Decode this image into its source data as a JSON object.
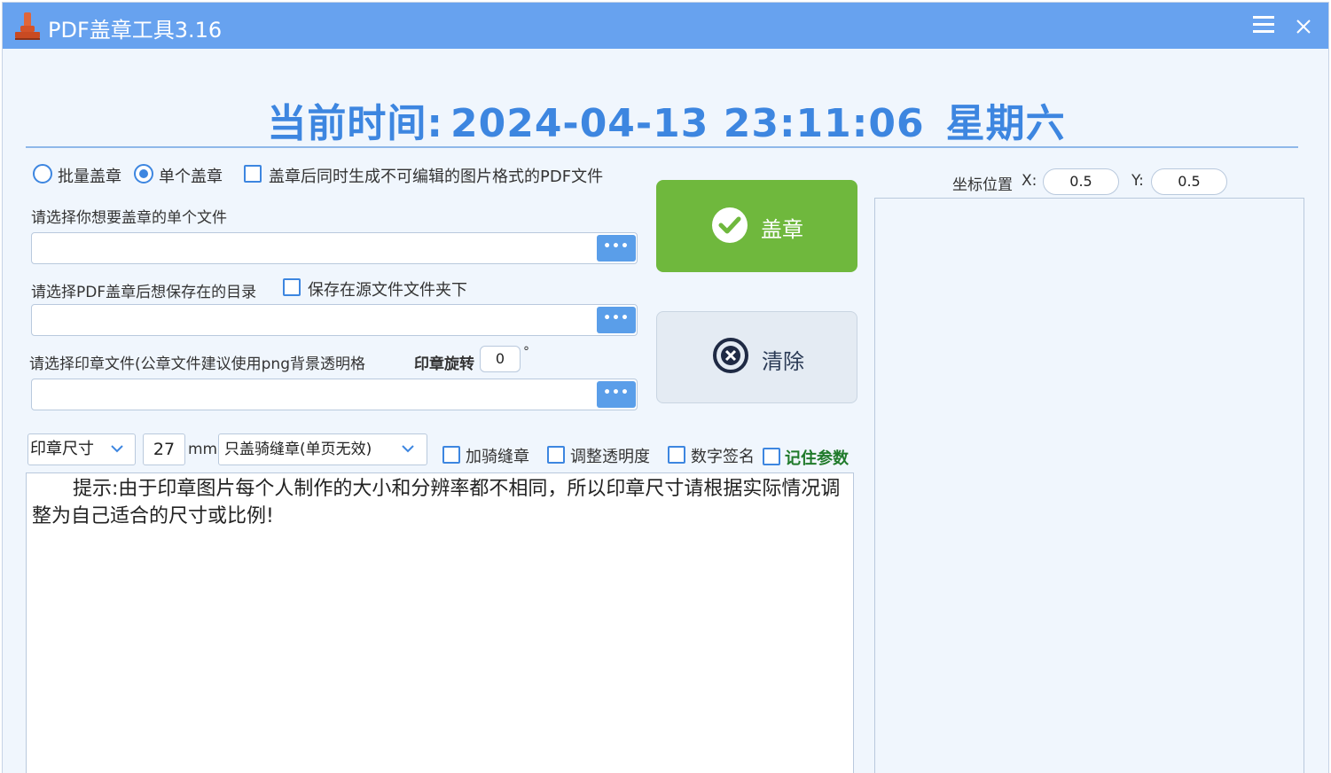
{
  "window": {
    "title": "PDF盖章工具3.16",
    "menu_icon": "hamburger-menu-icon",
    "close_icon": "close-icon",
    "app_icon": "stamp-icon"
  },
  "header": {
    "time_label": "当前时间:",
    "datetime": "2024-04-13 23:11:06",
    "weekday": "星期六"
  },
  "mode": {
    "batch_label": "批量盖章",
    "single_label": "单个盖章",
    "selected": "single",
    "image_pdf_label": "盖章后同时生成不可编辑的图片格式的PDF文件",
    "image_pdf_checked": false
  },
  "file_select": {
    "label": "请选择你想要盖章的单个文件",
    "value": "",
    "browse_label": "•••"
  },
  "save_dir": {
    "label": "请选择PDF盖章后想保存在的目录",
    "same_folder_label": "保存在源文件文件夹下",
    "same_folder_checked": false,
    "value": "",
    "browse_label": "•••"
  },
  "stamp_file": {
    "label": "请选择印章文件(公章文件建议使用png背景透明格",
    "rotate_label": "印章旋转",
    "rotate_value": "0",
    "degree_symbol": "°",
    "value": "",
    "browse_label": "•••"
  },
  "options": {
    "size_mode": "印章尺寸",
    "size_value": "27",
    "size_unit": "mm",
    "seam_mode": "只盖骑缝章(单页无效)",
    "seam_label": "加骑缝章",
    "transparency_label": "调整透明度",
    "digital_sign_label": "数字签名",
    "remember_label": "记住参数"
  },
  "hint": {
    "text": "提示:由于印章图片每个人制作的大小和分辨率都不相同，所以印章尺寸请根据实际情况调整为自己适合的尺寸或比例!"
  },
  "actions": {
    "stamp_label": "盖章",
    "clear_label": "清除",
    "stamp_color": "#6fb83d"
  },
  "position": {
    "label": "坐标位置",
    "x_label": "X:",
    "x_value": "0.5",
    "y_label": "Y:",
    "y_value": "0.5"
  },
  "colors": {
    "title_bar": "#67a2ef",
    "accent": "#3d86e0",
    "background": "#f0f6fd"
  }
}
